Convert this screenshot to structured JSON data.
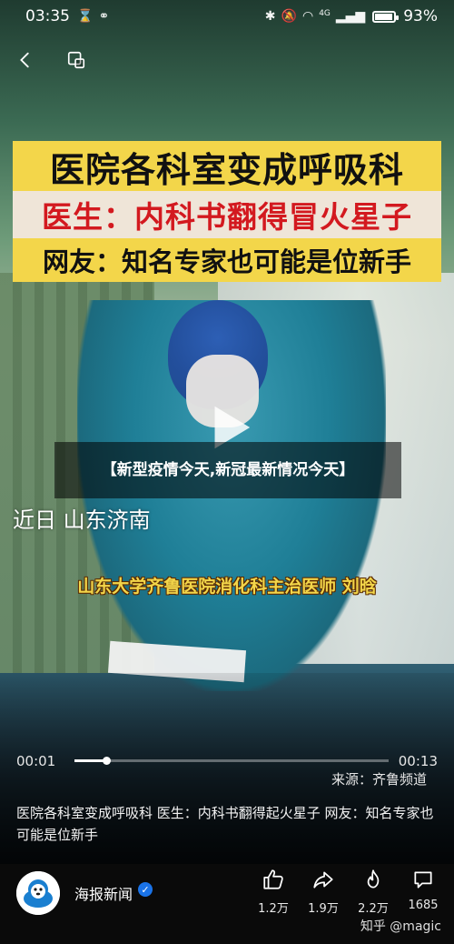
{
  "status_bar": {
    "time": "03:35",
    "battery_text": "93%",
    "battery_level": 0.93,
    "network": "4G"
  },
  "video": {
    "caption_line1": "医院各科室变成呼吸科",
    "caption_line2": "医生：内科书翻得冒火星子",
    "caption_line3": "网友：知名专家也可能是位新手",
    "overlay_title": "【新型疫情今天,新冠最新情况今天】",
    "subtitle_place": "近日 山东济南",
    "subtitle_doctor": "山东大学齐鲁医院消化科主治医师 刘晗",
    "current_time": "00:01",
    "total_time": "00:13",
    "progress": 0.1,
    "source": "来源：齐鲁频道"
  },
  "description": "医院各科室变成呼吸科 医生：内科书翻得起火星子 网友：知名专家也可能是位新手",
  "author": {
    "name": "海报新闻"
  },
  "actions": {
    "likes": "1.2万",
    "shares": "1.9万",
    "favorites": "2.2万",
    "comments": "1685"
  },
  "watermark": "知乎 @magic"
}
